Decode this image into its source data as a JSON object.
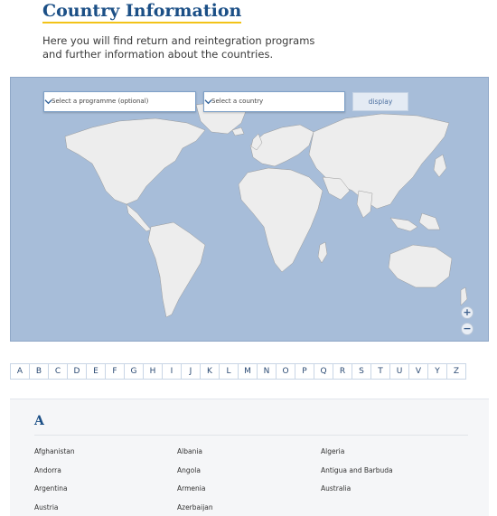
{
  "page": {
    "title": "Country Information",
    "intro": "Here you will find return and reintegration programs and further information about the countries."
  },
  "filters": {
    "programme_placeholder": "Select a programme (optional)",
    "country_placeholder": "Select a country",
    "display_label": "display"
  },
  "map": {
    "zoom_in": "+",
    "zoom_out": "−",
    "ocean_color": "#a7bdd9",
    "land_color": "#ededed"
  },
  "alphabet": [
    "A",
    "B",
    "C",
    "D",
    "E",
    "F",
    "G",
    "H",
    "I",
    "J",
    "K",
    "L",
    "M",
    "N",
    "O",
    "P",
    "Q",
    "R",
    "S",
    "T",
    "U",
    "V",
    "Y",
    "Z"
  ],
  "section": {
    "letter": "A",
    "countries": [
      "Afghanistan",
      "Albania",
      "Algeria",
      "Andorra",
      "Angola",
      "Antigua and Barbuda",
      "Argentina",
      "Armenia",
      "Australia",
      "Austria",
      "Azerbaijan"
    ]
  },
  "colors": {
    "brand": "#1b4f86",
    "accent": "#f2c318"
  }
}
